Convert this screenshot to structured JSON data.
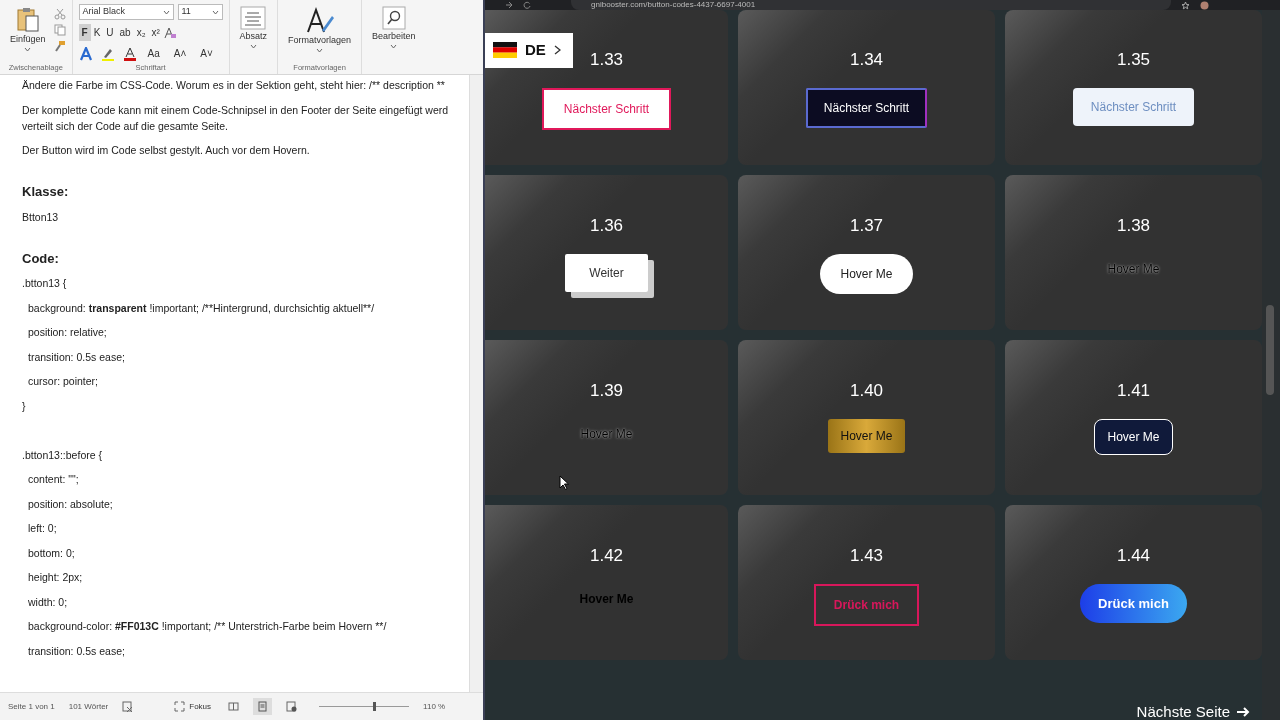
{
  "word": {
    "ribbon": {
      "font_name": "Arial Black",
      "font_size": "11",
      "format_buttons": [
        {
          "label": "F",
          "selected": true
        },
        {
          "label": "K",
          "selected": false
        },
        {
          "label": "U",
          "selected": false
        },
        {
          "label": "ab",
          "selected": false
        },
        {
          "label": "x₂",
          "selected": false
        },
        {
          "label": "x²",
          "selected": false
        }
      ],
      "size_buttons": [
        "Aa",
        "A˄",
        "A˅"
      ],
      "groups": [
        {
          "label": "Einfügen",
          "kind": "paste"
        },
        {
          "label": "Absatz",
          "kind": "paragraph"
        },
        {
          "label": "Formatvorlagen",
          "kind": "styles"
        },
        {
          "label": "Bearbeiten",
          "kind": "search"
        }
      ],
      "group_labels": [
        "Zwischenablage",
        "Schriftart",
        "Formatvorlagen"
      ]
    },
    "document": [
      {
        "kind": "text",
        "text": "Ändere die Farbe im CSS-Code. Worum es in der Sektion geht, steht hier: /** description **"
      },
      {
        "kind": "text",
        "text": "Der komplette Code kann mit einem Code-Schnipsel in den Footer der Seite eingefügt werd"
      },
      {
        "kind": "text",
        "text": "verteilt sich der Code auf die gesamte Seite.",
        "joined": true
      },
      {
        "kind": "text",
        "text": "Der Button wird im Code selbst gestylt. Auch vor dem Hovern."
      },
      {
        "kind": "heading",
        "text": "Klasse:"
      },
      {
        "kind": "text",
        "text": "Btton13"
      },
      {
        "kind": "heading",
        "text": "Code:"
      },
      {
        "kind": "brace",
        "parts": [
          {
            "text": ".btton13 {",
            "bold": false
          }
        ]
      },
      {
        "kind": "property",
        "parts": [
          {
            "text": "background: ",
            "bold": false
          },
          {
            "text": "transparent",
            "bold": true
          },
          {
            "text": " !important; /**Hintergrund, durchsichtig aktuell**/",
            "bold": false
          }
        ]
      },
      {
        "kind": "property",
        "parts": [
          {
            "text": "position: relative;",
            "bold": false
          }
        ]
      },
      {
        "kind": "property",
        "parts": [
          {
            "text": "transition: 0.5s ease;",
            "bold": false
          }
        ]
      },
      {
        "kind": "property",
        "parts": [
          {
            "text": "cursor: pointer;",
            "bold": false
          }
        ]
      },
      {
        "kind": "brace",
        "parts": [
          {
            "text": "}",
            "bold": false
          }
        ]
      },
      {
        "kind": "brace",
        "blank_line_before": true,
        "parts": [
          {
            "text": ".btton13::before {",
            "bold": false
          }
        ]
      },
      {
        "kind": "property",
        "parts": [
          {
            "text": "content: \"\";",
            "bold": false
          }
        ]
      },
      {
        "kind": "property",
        "parts": [
          {
            "text": "position: absolute;",
            "bold": false
          }
        ]
      },
      {
        "kind": "property",
        "parts": [
          {
            "text": "left: 0;",
            "bold": false
          }
        ]
      },
      {
        "kind": "property",
        "parts": [
          {
            "text": "bottom: 0;",
            "bold": false
          }
        ]
      },
      {
        "kind": "property",
        "parts": [
          {
            "text": "height: 2px;",
            "bold": false
          }
        ]
      },
      {
        "kind": "property",
        "parts": [
          {
            "text": "width: 0;",
            "bold": false
          }
        ]
      },
      {
        "kind": "property",
        "parts": [
          {
            "text": "background-color: ",
            "bold": false
          },
          {
            "text": "#FF013C",
            "bold": true
          },
          {
            "text": " !important; /** Unterstrich-Farbe beim Hovern **/",
            "bold": false
          }
        ]
      },
      {
        "kind": "property",
        "parts": [
          {
            "text": "transition: 0.5s ease;",
            "bold": false
          }
        ]
      }
    ],
    "status_bar": {
      "page": "Seite 1 von 1",
      "words": "101 Wörter",
      "focus": "Fokus",
      "zoom": "110 %",
      "level": 0.6
    }
  },
  "browser": {
    "url": "gnibooster.com/button-codes-4437-6697-4001",
    "language": "DE",
    "cards": [
      {
        "number": "1.33",
        "button": "Nächster Schritt",
        "kind": "outline-pink"
      },
      {
        "number": "1.34",
        "button": "Nächster Schritt",
        "kind": "dark-glow"
      },
      {
        "number": "1.35",
        "button": "Nächster Schritt",
        "kind": "light"
      },
      {
        "number": "1.36",
        "button": "Weiter",
        "kind": "block-3d"
      },
      {
        "number": "1.37",
        "button": "Hover Me",
        "kind": "white-pill"
      },
      {
        "number": "1.38",
        "button": "Hover Me",
        "kind": "plain"
      },
      {
        "number": "1.39",
        "button": "Hover Me",
        "kind": "plain"
      },
      {
        "number": "1.40",
        "button": "Hover Me",
        "kind": "gold"
      },
      {
        "number": "1.41",
        "button": "Hover Me",
        "kind": "navy-outline"
      },
      {
        "number": "1.42",
        "button": "Hover Me",
        "kind": "plain-bold"
      },
      {
        "number": "1.43",
        "button": "Drück mich",
        "kind": "outline-pink-bold"
      },
      {
        "number": "1.44",
        "button": "Drück mich",
        "kind": "blue-pill"
      }
    ],
    "next_page": "Nächste Seite"
  }
}
